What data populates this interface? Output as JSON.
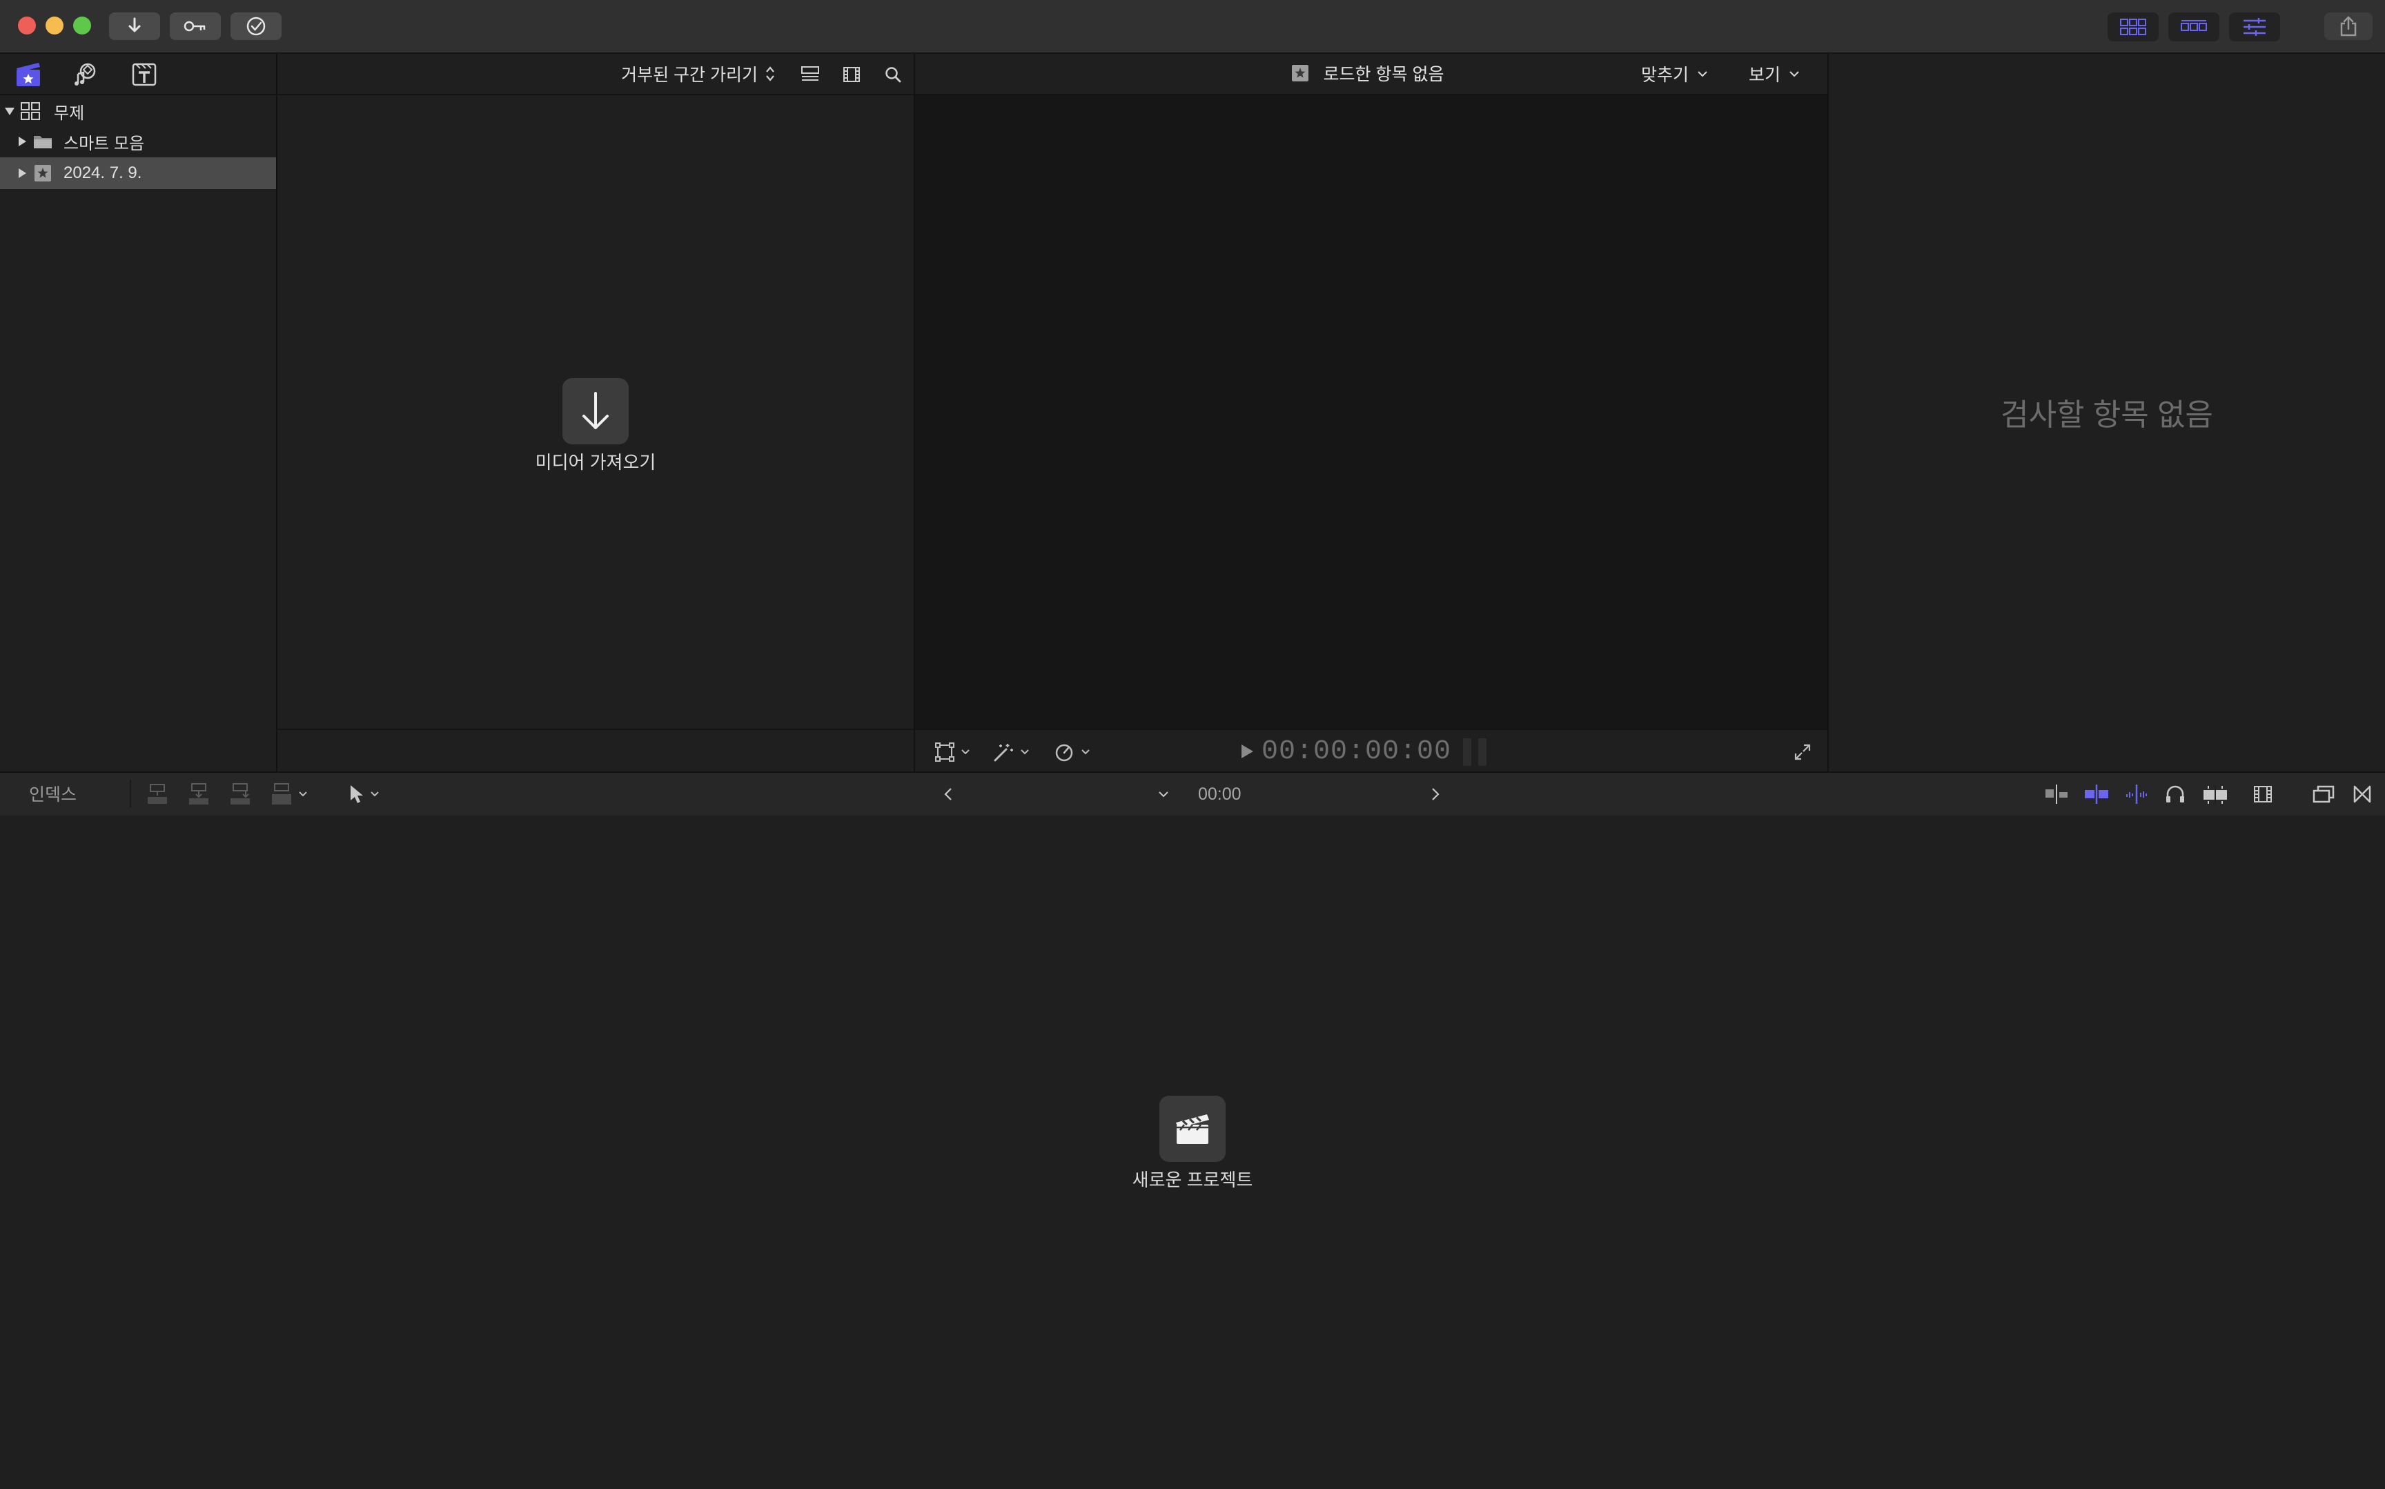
{
  "titlebar": {
    "toolbar_buttons": [
      {
        "icon": "download-arrow-icon"
      },
      {
        "icon": "key-icon"
      },
      {
        "icon": "checkmark-circle-icon"
      }
    ],
    "workspace_buttons": [
      {
        "icon": "browser-grid-icon"
      },
      {
        "icon": "timeline-icon"
      },
      {
        "icon": "inspector-sliders-icon"
      }
    ],
    "share_icon": "share-icon"
  },
  "sidebar": {
    "tabs": [
      {
        "icon": "libraries-clapper-icon",
        "active": true
      },
      {
        "icon": "photos-audio-icon",
        "active": false
      },
      {
        "icon": "titles-generators-icon",
        "active": false
      }
    ],
    "items": [
      {
        "label": "무제",
        "icon": "library-grid-icon",
        "expanded": true,
        "selected": false
      },
      {
        "label": "스마트 모음",
        "icon": "folder-icon",
        "expanded": false,
        "selected": false
      },
      {
        "label": "2024. 7. 9.",
        "icon": "event-star-icon",
        "expanded": false,
        "selected": true
      }
    ]
  },
  "browser": {
    "filter_label": "거부된 구간 가리기",
    "empty_label": "미디어 가져오기"
  },
  "viewer": {
    "title": "로드한 항목 없음",
    "fit_menu": "맞추기",
    "view_menu": "보기",
    "timecode": "00:00:00:00"
  },
  "inspector": {
    "empty_label": "검사할 항목 없음"
  },
  "timeline_toolbar": {
    "index_label": "인덱스",
    "timecode": "00:00"
  },
  "timeline": {
    "empty_label": "새로운 프로젝트"
  },
  "colors": {
    "accent": "#5a55e8",
    "background": "#1e1e1e",
    "titlebar": "#303030",
    "selected_row": "#4b4b4b"
  }
}
